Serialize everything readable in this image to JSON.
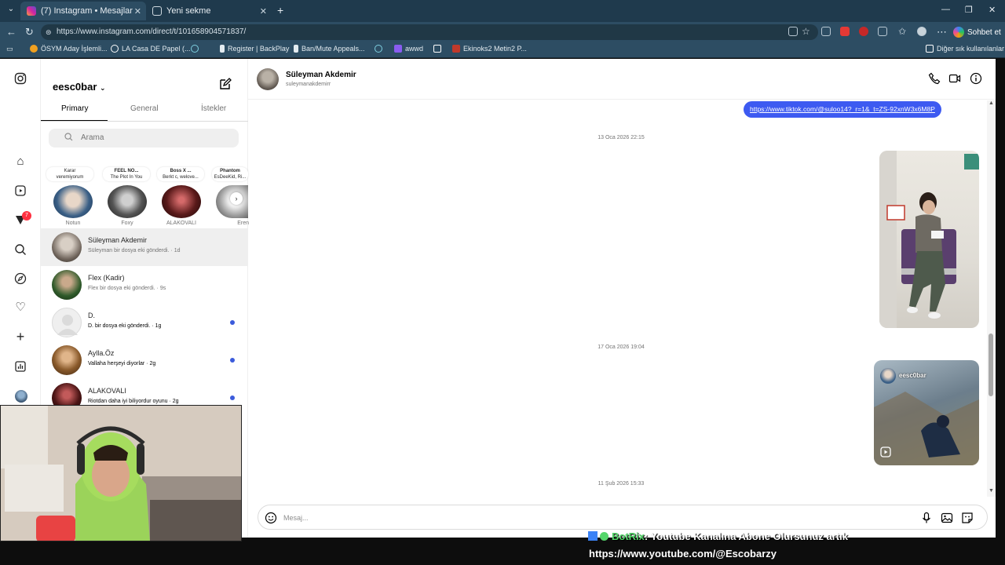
{
  "browser": {
    "tabs": [
      {
        "label": "(7) Instagram • Mesajlar",
        "active": true
      },
      {
        "label": "Yeni sekme",
        "active": false
      }
    ],
    "new_tab": "+",
    "url": "https://www.instagram.com/direct/t/101658904571837/",
    "chat_button": "Sohbet et",
    "bookmarks": [
      {
        "label": "ÖSYM Aday İşlemli...",
        "color": "#f0a020"
      },
      {
        "label": "LA Casa DE Papel (...",
        "color": "#ffffff"
      },
      {
        "label": "",
        "color": "#7fd0e0"
      },
      {
        "label": "Register | BackPlay",
        "color": "#ffffff"
      },
      {
        "label": "Ban/Mute Appeals...",
        "color": "#ffffff"
      },
      {
        "label": "",
        "color": "#7fd0e0"
      },
      {
        "label": "awwd",
        "color": "#8a5cf0"
      },
      {
        "label": "",
        "color": "#ffffff"
      },
      {
        "label": "Ekinoks2 Metin2 P...",
        "color": "#c0392b"
      }
    ],
    "other_favorites": "Diğer sık kullanılanlar"
  },
  "sidebar": {
    "notification_count": "7",
    "icons": [
      "instagram-icon",
      "home-icon",
      "reels-icon",
      "messages-icon",
      "search-icon",
      "explore-icon",
      "heart-icon",
      "create-icon",
      "dashboard-icon",
      "profile-icon"
    ]
  },
  "inbox": {
    "username": "eesc0bar",
    "tabs": [
      "Primary",
      "General",
      "İstekler"
    ],
    "search_placeholder": "Arama",
    "notes": [
      {
        "line1": "Karar",
        "line2": "veremiyorum"
      },
      {
        "line1": "FEEL NO...",
        "line2": "The Plot In You"
      },
      {
        "line1": "Boss X ...",
        "line2": "Berkt c, welove..."
      },
      {
        "line1": "Phantom",
        "line2": "EsDeeKid, Ri..."
      }
    ],
    "stories": [
      {
        "name": "Notun",
        "color": "#3a5f86"
      },
      {
        "name": "Foxy",
        "color": "#2c2c2c"
      },
      {
        "name": "ALAKOVALI",
        "color": "#5a1a1a"
      },
      {
        "name": "Eren",
        "color": "#dddddd"
      }
    ],
    "threads": [
      {
        "name": "Süleyman Akdemir",
        "preview": "Süleyman bir dosya eki gönderdi. · 1d",
        "unread": false,
        "selected": true,
        "color": "#6d6259"
      },
      {
        "name": "Flex (Kadir)",
        "preview": "Flex bir dosya eki gönderdi. · 9s",
        "unread": false,
        "selected": false,
        "color": "#2f5a2a"
      },
      {
        "name": "D.",
        "preview": "D. bir dosya eki gönderdi. · 1g",
        "unread": true,
        "selected": false,
        "color": "#dadada"
      },
      {
        "name": "Aylla.Öz",
        "preview": "Vallaha herşeyi diyorlar · 2g",
        "unread": true,
        "selected": false,
        "color": "#8a5a2b"
      },
      {
        "name": "ALAKOVALI",
        "preview": "Riotdan daha iyi biliyordur oyunu · 2g",
        "unread": true,
        "selected": false,
        "color": "#4a1414"
      }
    ]
  },
  "conversation": {
    "name": "Süleyman Akdemir",
    "username": "suleymanakdemirr",
    "link_message": "https://www.tiktok.com/@suloo14?_r=1&_t=ZS-92xnW3x6M8P",
    "timestamps": [
      "13 Oca 2026 22:15",
      "17 Oca 2026 19:04",
      "11 Şub 2026 15:33"
    ],
    "shared_reel_user": "eesc0bar",
    "message_placeholder": "Mesaj..."
  },
  "overlay": {
    "bot_name": "BotRix",
    "bot_message": ": Youtube Kanalına Abone Olursunuz artık",
    "bot_url": "https://www.youtube.com/@Escobarzy"
  }
}
